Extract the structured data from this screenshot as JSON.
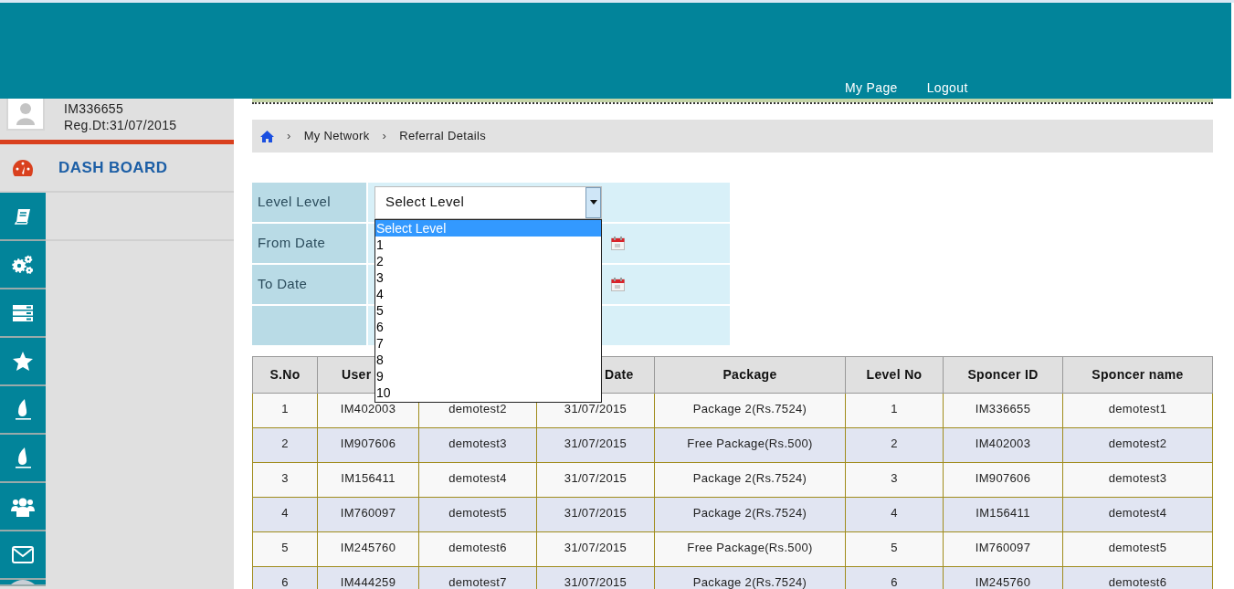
{
  "header": {
    "nav": [
      {
        "label": "My Page"
      },
      {
        "label": "Logout"
      }
    ]
  },
  "profile": {
    "user_id": "IM336655",
    "reg_date": "Reg.Dt:31/07/2015"
  },
  "sidebar": {
    "dashboard": {
      "label": "DASH BOARD"
    },
    "items": [
      {
        "kind": "book"
      },
      {
        "kind": "gears"
      },
      {
        "kind": "server"
      },
      {
        "kind": "star"
      },
      {
        "kind": "flame"
      },
      {
        "kind": "flame"
      },
      {
        "kind": "users"
      },
      {
        "kind": "envelope"
      },
      {
        "kind": "round"
      }
    ]
  },
  "breadcrumb": [
    {
      "separator": "›",
      "label": "My Network"
    },
    {
      "separator": "›",
      "label": "Referral Details"
    }
  ],
  "filter": {
    "rows": [
      {
        "label": "Level Level",
        "kind": "select"
      },
      {
        "label": "From Date",
        "kind": "date"
      },
      {
        "label": "To Date",
        "kind": "date"
      },
      {
        "kind": "empty"
      }
    ],
    "select": {
      "value": "Select Level",
      "expanded": true,
      "options": [
        {
          "label": "Select Level",
          "selected": true
        },
        {
          "label": "1",
          "selected": false
        },
        {
          "label": "2",
          "selected": false
        },
        {
          "label": "3",
          "selected": false
        },
        {
          "label": "4",
          "selected": false
        },
        {
          "label": "5",
          "selected": false
        },
        {
          "label": "6",
          "selected": false
        },
        {
          "label": "7",
          "selected": false
        },
        {
          "label": "8",
          "selected": false
        },
        {
          "label": "9",
          "selected": false
        },
        {
          "label": "10",
          "selected": false
        }
      ]
    }
  },
  "table": {
    "columns": [
      {
        "label": "S.No"
      },
      {
        "label": "User"
      },
      {},
      {
        "label": "Date"
      },
      {
        "label": "Package"
      },
      {
        "label": "Level No"
      },
      {
        "label": "Sponcer ID"
      },
      {
        "label": "Sponcer name"
      }
    ],
    "rows": [
      [
        "1",
        "IM402003",
        "demotest2",
        "31/07/2015",
        "Package 2(Rs.7524)",
        "1",
        "IM336655",
        "demotest1"
      ],
      [
        "2",
        "IM907606",
        "demotest3",
        "31/07/2015",
        "Free Package(Rs.500)",
        "2",
        "IM402003",
        "demotest2"
      ],
      [
        "3",
        "IM156411",
        "demotest4",
        "31/07/2015",
        "Package 2(Rs.7524)",
        "3",
        "IM907606",
        "demotest3"
      ],
      [
        "4",
        "IM760097",
        "demotest5",
        "31/07/2015",
        "Package 2(Rs.7524)",
        "4",
        "IM156411",
        "demotest4"
      ],
      [
        "5",
        "IM245760",
        "demotest6",
        "31/07/2015",
        "Free Package(Rs.500)",
        "5",
        "IM760097",
        "demotest5"
      ],
      [
        "6",
        "IM444259",
        "demotest7",
        "31/07/2015",
        "Package 2(Rs.7524)",
        "6",
        "IM245760",
        "demotest6"
      ]
    ]
  }
}
